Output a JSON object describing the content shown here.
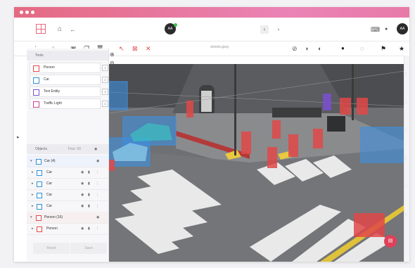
{
  "app": {
    "file_name": "streets.jpeg",
    "avatar_initials": "AA",
    "user_initials": "AA"
  },
  "tools": {
    "header": "Tools",
    "items": [
      {
        "label": "Person",
        "color": "#e04848",
        "key": "1"
      },
      {
        "label": "Car",
        "color": "#2e8fd8",
        "key": "2"
      },
      {
        "label": "Text Entity",
        "color": "#7b4fd0",
        "key": "3"
      },
      {
        "label": "Traffic Light",
        "color": "#d2408e",
        "key": "4"
      }
    ]
  },
  "objects": {
    "header": "Objects",
    "header_meta": "Total: 99",
    "groups": [
      {
        "label": "Car (4)",
        "color": "#2e8fd8"
      },
      {
        "label": "Person (16)",
        "color": "#e04848"
      }
    ],
    "items": [
      {
        "label": "Car",
        "color": "#2e8fd8"
      },
      {
        "label": "Car",
        "color": "#2e8fd8"
      },
      {
        "label": "Car",
        "color": "#2e8fd8"
      },
      {
        "label": "Car",
        "color": "#2e8fd8"
      },
      {
        "label": "Person",
        "color": "#e04848"
      }
    ]
  },
  "buttons": {
    "reset": "Reset",
    "save": "Save"
  },
  "icons": {
    "grid": "▦",
    "home": "⌂",
    "back": "←",
    "nav_prev": "‹",
    "nav_next": "›",
    "keyboard": "⌨",
    "bell": "●",
    "pan": "⋮",
    "upload": "⇪",
    "image": "▣",
    "copy": "❐",
    "trash": "🗑",
    "pointer": "↖",
    "box": "⊠",
    "cross": "✕",
    "check": "⊘",
    "undo": "◑",
    "redo": "◐",
    "pin": "●",
    "comment": "◌",
    "flag": "⚑",
    "star": "★",
    "zoom_in": "⊕",
    "zoom_out": "⊖",
    "fit": "⛶",
    "eye": "◉",
    "lock": "▮",
    "more": "⋮",
    "expand": "▸",
    "collapse": "▾",
    "fab": "▤"
  }
}
